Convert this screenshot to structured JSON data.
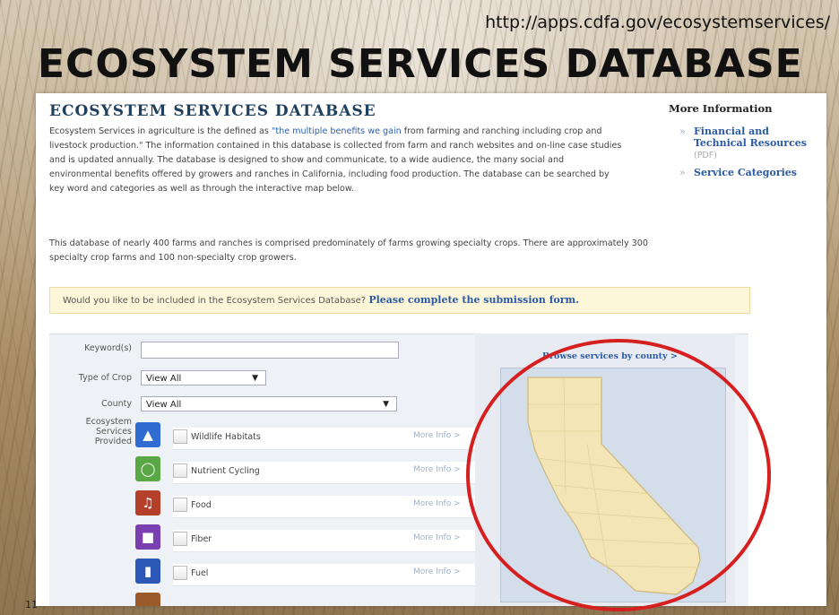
{
  "slide": {
    "url": "http://apps.cdfa.gov/ecosystemservices/",
    "title": "ECOSYSTEM SERVICES DATABASE",
    "page_number": "11"
  },
  "page": {
    "title": "ECOSYSTEM SERVICES DATABASE",
    "intro_before_link": "Ecosystem Services in agriculture is the defined as ",
    "intro_link": "\"the multiple benefits we gain",
    "intro_after_link": " from farming and ranching including crop and livestock production.\" The information contained in this database is collected from farm and ranch websites and on-line case studies and is updated annually. The database is designed to show and communicate, to a wide audience, the many social and environmental benefits offered by growers and ranches in California, including food production. The database can be searched by key word and categories as well as through the interactive map below.",
    "paragraph2": "This database of nearly 400 farms and ranches is comprised predominately of farms growing specialty crops. There are approximately 300 specialty crop farms and 100 non-specialty crop growers."
  },
  "more_info": {
    "heading": "More Information",
    "items": [
      {
        "label": "Financial and Technical Resources",
        "tag": "(PDF)"
      },
      {
        "label": "Service Categories",
        "tag": ""
      }
    ]
  },
  "banner": {
    "text": "Would you like to be included in the Ecosystem Services Database?",
    "link": "Please complete the submission form."
  },
  "search": {
    "keyword_label": "Keyword(s)",
    "keyword_value": "",
    "crop_label": "Type of Crop",
    "crop_value": "View All",
    "county_label": "County",
    "county_value": "View All",
    "services_label": "Ecosystem Services Provided",
    "services": [
      {
        "label": "Wildlife Habitats",
        "more": "More Info >",
        "icon": "wildlife-icon",
        "color": "#2f6bd1"
      },
      {
        "label": "Nutrient Cycling",
        "more": "More Info >",
        "icon": "nutrient-icon",
        "color": "#5aa845"
      },
      {
        "label": "Food",
        "more": "More Info >",
        "icon": "food-icon",
        "color": "#b5402a"
      },
      {
        "label": "Fiber",
        "more": "More Info >",
        "icon": "fiber-icon",
        "color": "#7a3fb0"
      },
      {
        "label": "Fuel",
        "more": "More Info >",
        "icon": "fuel-icon",
        "color": "#2c58b8"
      }
    ]
  },
  "map": {
    "browse_label": "Browse services by county >"
  },
  "colors": {
    "accent": "#2a5aa6",
    "highlight_circle": "#d61f1f"
  }
}
